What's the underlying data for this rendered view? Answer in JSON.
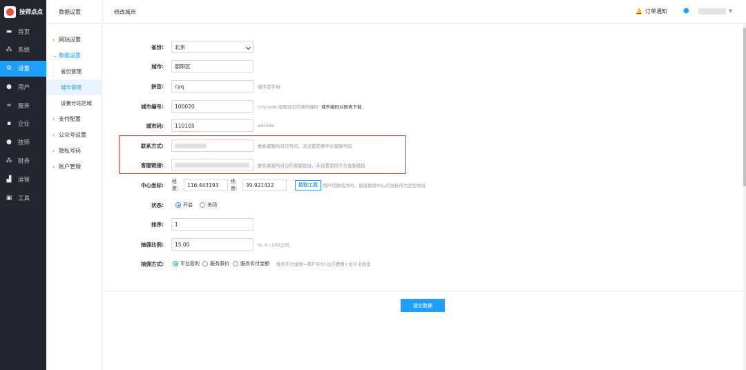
{
  "app": {
    "name": "技师点点"
  },
  "sidebar": {
    "items": [
      {
        "label": "首页",
        "icon": "monitor-icon"
      },
      {
        "label": "系统",
        "icon": "sitemap-icon"
      },
      {
        "label": "设置",
        "icon": "gear-icon",
        "active": true
      },
      {
        "label": "用户",
        "icon": "user-icon"
      },
      {
        "label": "服务",
        "icon": "link-icon"
      },
      {
        "label": "企业",
        "icon": "building-icon"
      },
      {
        "label": "技师",
        "icon": "person-icon"
      },
      {
        "label": "财务",
        "icon": "network-icon"
      },
      {
        "label": "运营",
        "icon": "chart-icon"
      },
      {
        "label": "工具",
        "icon": "toolbox-icon"
      }
    ]
  },
  "header": {
    "section_title": "数据设置",
    "page_title": "修改城市",
    "notify_label": "订单通知"
  },
  "subnav": {
    "website": "网站设置",
    "data": "数据设置",
    "data_children": [
      "省份管理",
      "城市管理",
      "设置分站区域"
    ],
    "payment": "支付配置",
    "official": "公众号设置",
    "privacy": "隐私号码",
    "account": "账户管理"
  },
  "form": {
    "province": {
      "label": "省份:",
      "value": "北京"
    },
    "city": {
      "label": "城市:",
      "value": "朝阳区"
    },
    "pinyin": {
      "label": "拼音:",
      "value": "cyq",
      "hint": "城市首字母"
    },
    "city_code": {
      "label": "城市编号:",
      "value": "100020",
      "hint": "citycode,地图对应的城市编码",
      "hint_link": "城市编码对照表下载"
    },
    "adcode": {
      "label": "城市码:",
      "value": "110105",
      "hint": "adcode"
    },
    "contact": {
      "label": "联系方式:",
      "hint": "联系客服所对应号码，未设置使用平台客服号码"
    },
    "service_link": {
      "label": "客服链接:",
      "hint": "联系客服所对应的客服链接，未设置使用平台客服链接"
    },
    "center": {
      "label": "中心坐标:",
      "lng_label": "经度:",
      "lng": "116.443193",
      "lat_label": "纬度:",
      "lat": "39.921422",
      "pick_button": "拾取工具",
      "hint": "用户切换站点时，直接使用中心点坐标作为定位地址"
    },
    "status": {
      "label": "状态:",
      "options": [
        "开启",
        "关闭"
      ],
      "selected": "开启"
    },
    "sort": {
      "label": "排序:",
      "value": "1"
    },
    "commission_rate": {
      "label": "抽佣比例:",
      "value": "15.00",
      "hint": "%, 0~100之间"
    },
    "commission_mode": {
      "label": "抽佣方式:",
      "options": [
        "平台盈利",
        "服务原价",
        "服务实付金额"
      ],
      "selected": "平台盈利",
      "hint": "服务实付金额=用户实付-出行费用+出行卡抵扣"
    },
    "submit_label": "提交数据"
  },
  "colors": {
    "accent": "#1e9fff",
    "sidebar_bg": "#23262e",
    "highlight": "#e23b35"
  }
}
